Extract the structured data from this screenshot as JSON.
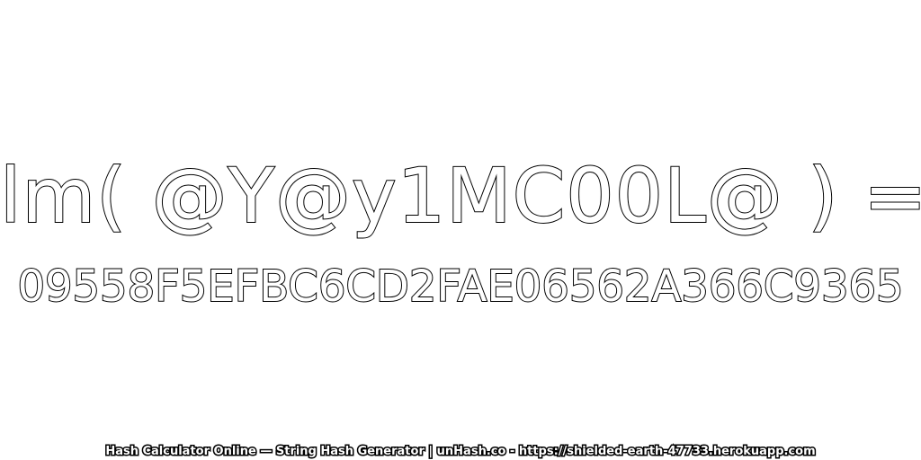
{
  "input_text": "lm( @Y@y1MC00L@ ) =",
  "hash_value": "09558F5EFBC6CD2FAE06562A366C9365",
  "footer_text": "Hash Calculator Online — String Hash Generator | unHash.co - https://shielded-earth-47733.herokuapp.com",
  "colors": {
    "background": "#ffffff",
    "text_fill": "#ffffff",
    "text_outline": "#000000"
  }
}
